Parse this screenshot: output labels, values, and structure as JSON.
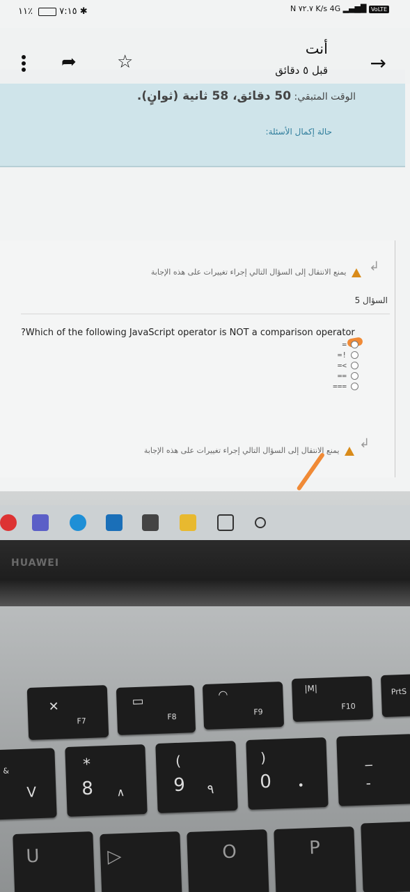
{
  "status_bar": {
    "time": "٧:١٥",
    "battery": "٪١١",
    "network_speed": "٧٢.٧",
    "network_unit": "K/s",
    "network_type": "4G",
    "volte": "VoLTE"
  },
  "notification": {
    "sender": "أنت",
    "time_ago": "قبل ٥ دقائق"
  },
  "quiz": {
    "timer_label": "الوقت المتبقي:",
    "timer_value": "50 دقائق، 58 ثانية (ثوانٍ).",
    "status_link": "حالة إكمال الأسئلة:",
    "no_back_warning": "يمنع الانتقال إلى السؤال التالي إجراء تغييرات على هذه الإجابة",
    "question_label": "السؤال 5",
    "question_text": "?Which of the following JavaScript operator is NOT a comparison operator",
    "options": [
      "=",
      "=!",
      "=<",
      "==",
      "==="
    ],
    "selected_index": 0
  },
  "laptop": {
    "brand": "HUAWEI",
    "keys": {
      "f7": "F7",
      "f8": "F8",
      "f9": "F9",
      "f10": "F10",
      "prtsc": "PrtS",
      "eight": "8",
      "star": "*",
      "nine": "9",
      "open_paren": "(",
      "zero": "0",
      "close_paren": ")",
      "v": "V",
      "u": "U",
      "p": "P",
      "amp": "&"
    }
  },
  "colors": {
    "pen": "#f08a36",
    "timer_panel": "#cfe4ea",
    "warning": "#d98b1a"
  }
}
